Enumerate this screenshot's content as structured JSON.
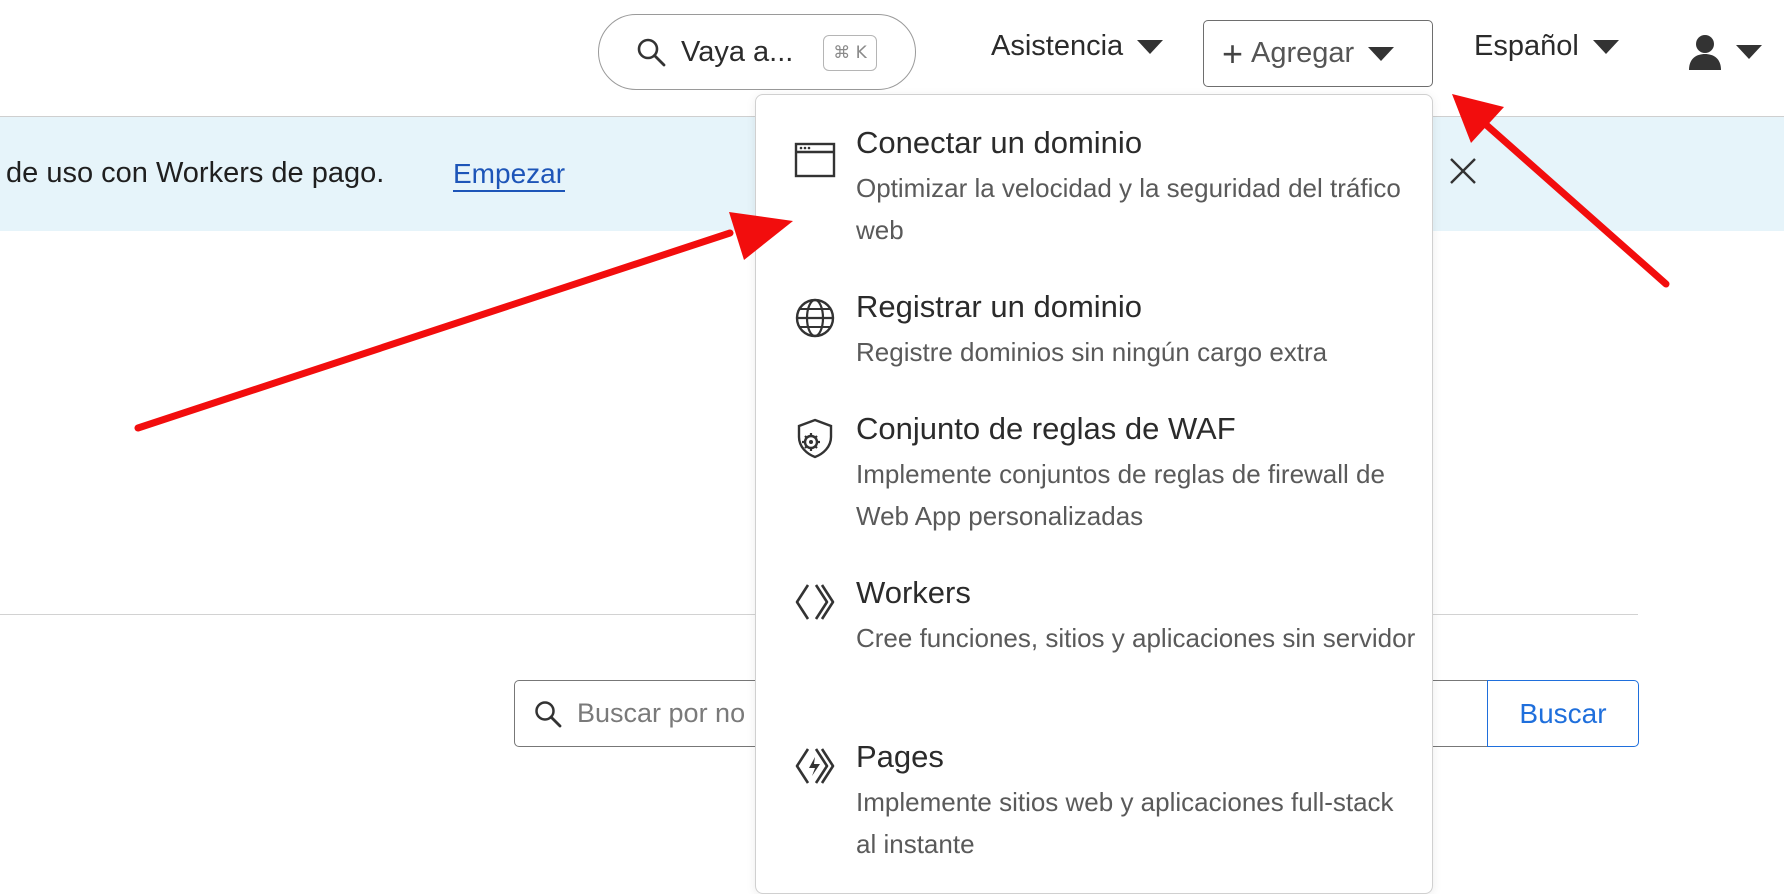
{
  "header": {
    "quick_search": {
      "label": "Vaya a...",
      "shortcut": "⌘ K"
    },
    "help_label": "Asistencia",
    "add_label": "Agregar",
    "language_label": "Español"
  },
  "banner": {
    "text": "de uso con Workers de pago.",
    "link": "Empezar"
  },
  "search": {
    "placeholder": "Buscar por no",
    "button": "Buscar"
  },
  "add_menu": {
    "items": [
      {
        "title": "Conectar un dominio",
        "desc": "Optimizar la velocidad y la seguridad del tráfico web",
        "icon": "browser-window-icon"
      },
      {
        "title": "Registrar un dominio",
        "desc": "Registre dominios sin ningún cargo extra",
        "icon": "globe-icon"
      },
      {
        "title": "Conjunto de reglas de WAF",
        "desc": "Implemente conjuntos de reglas de firewall de Web App personalizadas",
        "icon": "shield-gear-icon"
      },
      {
        "title": "Workers",
        "desc": "Cree funciones, sitios y aplicaciones sin servidor",
        "icon": "workers-icon"
      },
      {
        "title": "Pages",
        "desc": "Implemente sitios web y aplicaciones full-stack al instante",
        "icon": "pages-icon"
      }
    ]
  },
  "colors": {
    "banner_bg": "#e6f4fa",
    "link": "#1d55b8",
    "primary_button": "#1f6fdc",
    "annotation_arrow": "#f20d0d"
  }
}
